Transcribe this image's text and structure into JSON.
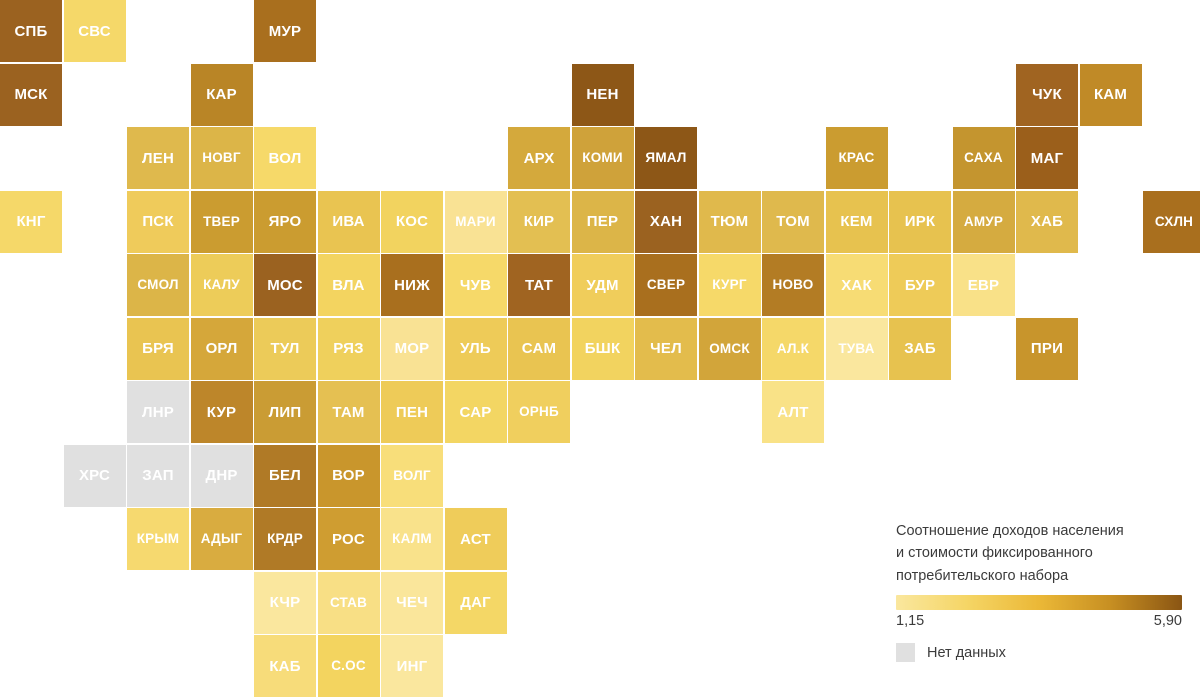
{
  "chart_data": {
    "type": "heatmap",
    "title": "Соотношение доходов населения и стоимости фиксированного потребительского набора",
    "colorbar": {
      "min_label": "1,15",
      "max_label": "5,90",
      "min_value": 1.15,
      "max_value": 5.9,
      "gradient_stops": [
        "#fae79e",
        "#f5d565",
        "#ebb837",
        "#c78f22",
        "#8a5513"
      ]
    },
    "nodata_label": "Нет данных",
    "nodata_color": "#e0e0e0",
    "grid": {
      "cell": 62,
      "pitch": 63.5,
      "origin_x": 0,
      "origin_y": 0
    },
    "tiles": [
      {
        "code": "СПБ",
        "col": 0,
        "row": 0,
        "color": "#9b6220"
      },
      {
        "code": "СВС",
        "col": 1,
        "row": 0,
        "color": "#f5d869"
      },
      {
        "code": "МУР",
        "col": 4,
        "row": 0,
        "color": "#a96f1e"
      },
      {
        "code": "МСК",
        "col": 0,
        "row": 1,
        "color": "#9b6220"
      },
      {
        "code": "КАР",
        "col": 3,
        "row": 1,
        "color": "#b98526"
      },
      {
        "code": "НЕН",
        "col": 9,
        "row": 1,
        "color": "#8d5717"
      },
      {
        "code": "ЧУК",
        "col": 16,
        "row": 1,
        "color": "#a06421"
      },
      {
        "code": "КАМ",
        "col": 17,
        "row": 1,
        "color": "#c08a27"
      },
      {
        "code": "ЛЕН",
        "col": 2,
        "row": 2,
        "color": "#dfb94d"
      },
      {
        "code": "НОВГ",
        "col": 3,
        "row": 2,
        "color": "#dcb548"
      },
      {
        "code": "ВОЛ",
        "col": 4,
        "row": 2,
        "color": "#f6d969"
      },
      {
        "code": "АРХ",
        "col": 8,
        "row": 2,
        "color": "#d4a93c"
      },
      {
        "code": "КОМИ",
        "col": 9,
        "row": 2,
        "color": "#cfa23a"
      },
      {
        "code": "ЯМАЛ",
        "col": 10,
        "row": 2,
        "color": "#8d5717"
      },
      {
        "code": "КРАС",
        "col": 13,
        "row": 2,
        "color": "#cb9c30"
      },
      {
        "code": "САХА",
        "col": 15,
        "row": 2,
        "color": "#c4952f"
      },
      {
        "code": "МАГ",
        "col": 16,
        "row": 2,
        "color": "#9b5f1b"
      },
      {
        "code": "КНГ",
        "col": 0,
        "row": 3,
        "color": "#f5d869"
      },
      {
        "code": "ПСК",
        "col": 2,
        "row": 3,
        "color": "#efcb5b"
      },
      {
        "code": "ТВЕР",
        "col": 3,
        "row": 3,
        "color": "#cb9c30"
      },
      {
        "code": "ЯРО",
        "col": 4,
        "row": 3,
        "color": "#cb9c30"
      },
      {
        "code": "ИВА",
        "col": 5,
        "row": 3,
        "color": "#e9c451"
      },
      {
        "code": "КОС",
        "col": 6,
        "row": 3,
        "color": "#f2d35f"
      },
      {
        "code": "МАРИ",
        "col": 7,
        "row": 3,
        "color": "#f9e294"
      },
      {
        "code": "КИР",
        "col": 8,
        "row": 3,
        "color": "#e3bf52"
      },
      {
        "code": "ПЕР",
        "col": 9,
        "row": 3,
        "color": "#dcb548"
      },
      {
        "code": "ХАН",
        "col": 10,
        "row": 3,
        "color": "#9b6220"
      },
      {
        "code": "ТЮМ",
        "col": 11,
        "row": 3,
        "color": "#e0b94c"
      },
      {
        "code": "ТОМ",
        "col": 12,
        "row": 3,
        "color": "#dfb94d"
      },
      {
        "code": "КЕМ",
        "col": 13,
        "row": 3,
        "color": "#e7c24f"
      },
      {
        "code": "ИРК",
        "col": 14,
        "row": 3,
        "color": "#e7c24f"
      },
      {
        "code": "АМУР",
        "col": 15,
        "row": 3,
        "color": "#d5ab40"
      },
      {
        "code": "ХАБ",
        "col": 16,
        "row": 3,
        "color": "#e0b94c"
      },
      {
        "code": "СХЛН",
        "col": 18,
        "row": 3,
        "color": "#a96f1e"
      },
      {
        "code": "СМОЛ",
        "col": 2,
        "row": 4,
        "color": "#dcb548"
      },
      {
        "code": "КАЛУ",
        "col": 3,
        "row": 4,
        "color": "#edcc59"
      },
      {
        "code": "МОС",
        "col": 4,
        "row": 4,
        "color": "#9b6220"
      },
      {
        "code": "ВЛА",
        "col": 5,
        "row": 4,
        "color": "#f3d460"
      },
      {
        "code": "НИЖ",
        "col": 6,
        "row": 4,
        "color": "#a96f1e"
      },
      {
        "code": "ЧУВ",
        "col": 7,
        "row": 4,
        "color": "#f6d969"
      },
      {
        "code": "ТАТ",
        "col": 8,
        "row": 4,
        "color": "#a06421"
      },
      {
        "code": "УДМ",
        "col": 9,
        "row": 4,
        "color": "#f0cd5b"
      },
      {
        "code": "СВЕР",
        "col": 10,
        "row": 4,
        "color": "#a96f1e"
      },
      {
        "code": "КУРГ",
        "col": 11,
        "row": 4,
        "color": "#f6d969"
      },
      {
        "code": "НОВО",
        "col": 12,
        "row": 4,
        "color": "#b37c24"
      },
      {
        "code": "ХАК",
        "col": 13,
        "row": 4,
        "color": "#f7dc74"
      },
      {
        "code": "БУР",
        "col": 14,
        "row": 4,
        "color": "#eecb58"
      },
      {
        "code": "ЕВР",
        "col": 15,
        "row": 4,
        "color": "#f9e188"
      },
      {
        "code": "БРЯ",
        "col": 2,
        "row": 5,
        "color": "#e9c451"
      },
      {
        "code": "ОРЛ",
        "col": 3,
        "row": 5,
        "color": "#d5a73a"
      },
      {
        "code": "ТУЛ",
        "col": 4,
        "row": 5,
        "color": "#eccb59"
      },
      {
        "code": "РЯЗ",
        "col": 5,
        "row": 5,
        "color": "#efd05c"
      },
      {
        "code": "МОР",
        "col": 6,
        "row": 5,
        "color": "#f9e294"
      },
      {
        "code": "УЛЬ",
        "col": 7,
        "row": 5,
        "color": "#eecb58"
      },
      {
        "code": "САМ",
        "col": 8,
        "row": 5,
        "color": "#e9c451"
      },
      {
        "code": "БШК",
        "col": 9,
        "row": 5,
        "color": "#f2d35f"
      },
      {
        "code": "ЧЕЛ",
        "col": 10,
        "row": 5,
        "color": "#e3bc4c"
      },
      {
        "code": "ОМСК",
        "col": 11,
        "row": 5,
        "color": "#d2a53a"
      },
      {
        "code": "АЛ.К",
        "col": 12,
        "row": 5,
        "color": "#f5d869"
      },
      {
        "code": "ТУВА",
        "col": 13,
        "row": 5,
        "color": "#fae79e"
      },
      {
        "code": "ЗАБ",
        "col": 14,
        "row": 5,
        "color": "#e7c24f"
      },
      {
        "code": "ПРИ",
        "col": 16,
        "row": 5,
        "color": "#c8952c"
      },
      {
        "code": "ЛНР",
        "col": 2,
        "row": 6,
        "color": "#e0e0e0",
        "nodata": true
      },
      {
        "code": "КУР",
        "col": 3,
        "row": 6,
        "color": "#bd862a"
      },
      {
        "code": "ЛИП",
        "col": 4,
        "row": 6,
        "color": "#ca9c34"
      },
      {
        "code": "ТАМ",
        "col": 5,
        "row": 6,
        "color": "#e5c052"
      },
      {
        "code": "ПЕН",
        "col": 6,
        "row": 6,
        "color": "#eecb58"
      },
      {
        "code": "САР",
        "col": 7,
        "row": 6,
        "color": "#f3d663"
      },
      {
        "code": "ОРНБ",
        "col": 8,
        "row": 6,
        "color": "#f0cf5e"
      },
      {
        "code": "АЛТ",
        "col": 12,
        "row": 6,
        "color": "#f9e287"
      },
      {
        "code": "ХРС",
        "col": 1,
        "row": 7,
        "color": "#e0e0e0",
        "nodata": true
      },
      {
        "code": "ЗАП",
        "col": 2,
        "row": 7,
        "color": "#e0e0e0",
        "nodata": true
      },
      {
        "code": "ДНР",
        "col": 3,
        "row": 7,
        "color": "#e0e0e0",
        "nodata": true
      },
      {
        "code": "БЕЛ",
        "col": 4,
        "row": 7,
        "color": "#b07a26"
      },
      {
        "code": "ВОР",
        "col": 5,
        "row": 7,
        "color": "#c9962c"
      },
      {
        "code": "ВОЛГ",
        "col": 6,
        "row": 7,
        "color": "#f8de7a"
      },
      {
        "code": "КРЫМ",
        "col": 2,
        "row": 8,
        "color": "#f6d96f"
      },
      {
        "code": "АДЫГ",
        "col": 3,
        "row": 8,
        "color": "#d9ac40"
      },
      {
        "code": "КРДР",
        "col": 4,
        "row": 8,
        "color": "#b07a26"
      },
      {
        "code": "РОС",
        "col": 5,
        "row": 8,
        "color": "#cf9d31"
      },
      {
        "code": "КАЛМ",
        "col": 6,
        "row": 8,
        "color": "#f9e28b"
      },
      {
        "code": "АСТ",
        "col": 7,
        "row": 8,
        "color": "#efcc5a"
      },
      {
        "code": "КЧР",
        "col": 4,
        "row": 9,
        "color": "#fae79e"
      },
      {
        "code": "СТАВ",
        "col": 5,
        "row": 9,
        "color": "#f8df85"
      },
      {
        "code": "ЧЕЧ",
        "col": 6,
        "row": 9,
        "color": "#fae69b"
      },
      {
        "code": "ДАГ",
        "col": 7,
        "row": 9,
        "color": "#f4d766"
      },
      {
        "code": "КАБ",
        "col": 4,
        "row": 10,
        "color": "#f7dc7a"
      },
      {
        "code": "С.ОС",
        "col": 5,
        "row": 10,
        "color": "#f3d45f"
      },
      {
        "code": "ИНГ",
        "col": 6,
        "row": 10,
        "color": "#fae79e"
      }
    ]
  },
  "legend": {
    "title_lines": [
      "Соотношение доходов населения",
      "и стоимости фиксированного",
      "потребительского набора"
    ],
    "min_label": "1,15",
    "max_label": "5,90",
    "nodata_label": "Нет данных"
  }
}
